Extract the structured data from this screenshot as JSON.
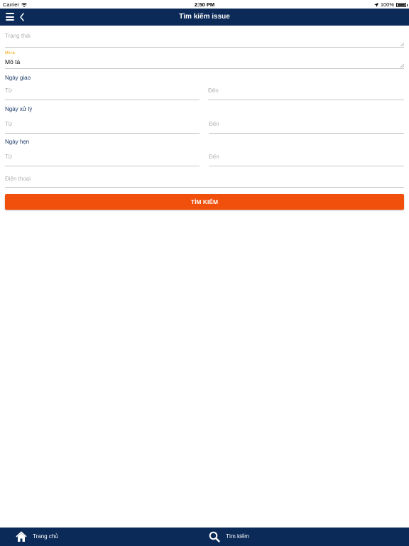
{
  "status_bar": {
    "carrier": "Carrier",
    "time": "2:50 PM",
    "battery": "100%",
    "battery_level": 1.0
  },
  "nav_bar": {
    "title": "Tìm kiếm issue",
    "menu_icon": "hamburger-menu-icon",
    "back_icon": "chevron-left-icon"
  },
  "form": {
    "status": {
      "placeholder": "Trạng thái"
    },
    "description": {
      "label": "Mô tả",
      "value": "Mô tả"
    },
    "assigned_date": {
      "label": "Ngày giao",
      "from_placeholder": "Từ",
      "to_placeholder": "Đến"
    },
    "processed_date": {
      "label": "Ngày xử lý",
      "from_placeholder": "Từ",
      "to_placeholder": "Đến"
    },
    "appointment_date": {
      "label": "Ngày hẹn",
      "from_placeholder": "Từ",
      "to_placeholder": "Đến"
    },
    "phone": {
      "placeholder": "Điện thoại"
    },
    "search_button_label": "TÌM KIẾM"
  },
  "tab_bar": {
    "items": [
      {
        "label": "Trang chủ",
        "icon": "home-icon"
      },
      {
        "label": "Tìm kiếm",
        "icon": "search-icon"
      }
    ]
  },
  "colors": {
    "nav_background": "#0b2a57",
    "accent_button": "#f04f0c",
    "floating_label": "#f0a000",
    "section_label": "#1f3d6b"
  }
}
